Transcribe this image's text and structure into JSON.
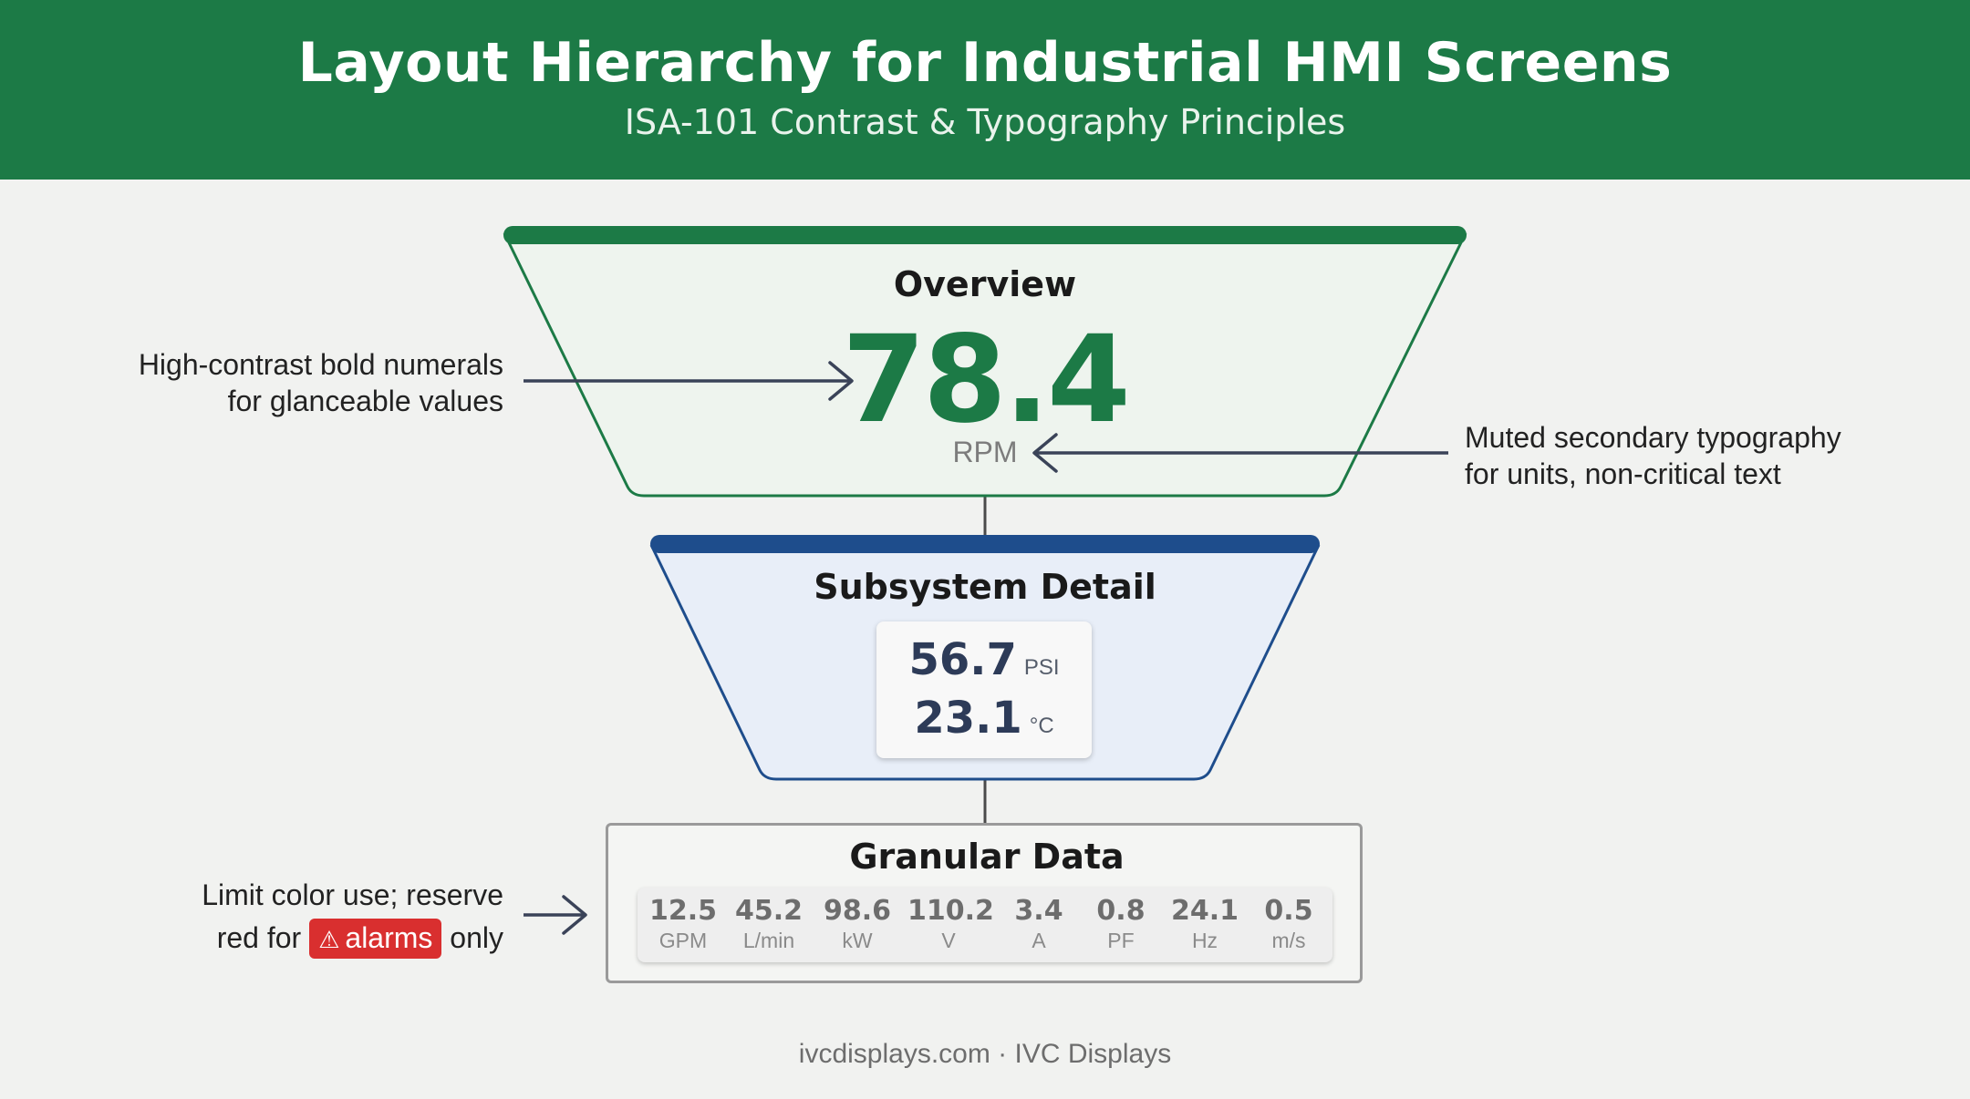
{
  "header": {
    "title": "Layout Hierarchy for Industrial HMI Screens",
    "subtitle": "ISA-101 Contrast & Typography Principles"
  },
  "overview": {
    "heading": "Overview",
    "value": "78.4",
    "unit": "RPM"
  },
  "subsystem": {
    "heading": "Subsystem Detail",
    "readings": [
      {
        "value": "56.7",
        "unit": "PSI"
      },
      {
        "value": "23.1",
        "unit": "°C"
      }
    ]
  },
  "granular": {
    "heading": "Granular Data",
    "cells": [
      {
        "value": "12.5",
        "unit": "GPM"
      },
      {
        "value": "45.2",
        "unit": "L/min"
      },
      {
        "value": "98.6",
        "unit": "kW"
      },
      {
        "value": "110.2",
        "unit": "V"
      },
      {
        "value": "3.4",
        "unit": "A"
      },
      {
        "value": "0.8",
        "unit": "PF"
      },
      {
        "value": "24.1",
        "unit": "Hz"
      },
      {
        "value": "0.5",
        "unit": "m/s"
      }
    ]
  },
  "annotations": {
    "left_top": [
      "High-contrast bold numerals",
      "for glanceable values"
    ],
    "right": [
      "Muted secondary typography",
      "for units, non-critical text"
    ],
    "left_bottom": {
      "line1": "Limit color use; reserve",
      "line2_prefix": "red for",
      "badge": "alarms",
      "line2_suffix": "only"
    }
  },
  "footer": "ivcdisplays.com · IVC Displays",
  "colors": {
    "brand_green": "#1c7a46",
    "subsystem_blue": "#1e4d8c",
    "alarm_red": "#d92f2f",
    "arrow": "#3a4358"
  },
  "icons": {
    "alarm": "warning-triangle-icon"
  }
}
